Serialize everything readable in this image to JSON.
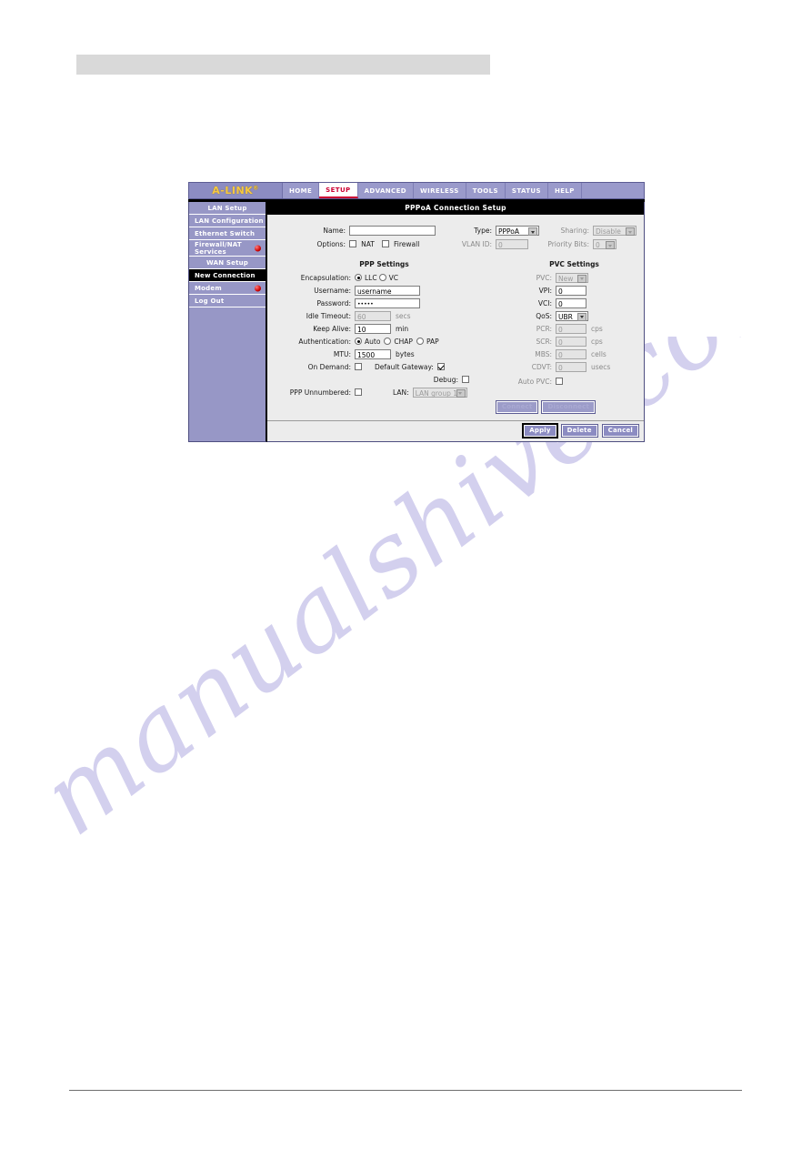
{
  "brand": {
    "name": "A-LINK",
    "trademark": "®"
  },
  "nav": {
    "tabs": [
      {
        "label": "HOME",
        "active": false
      },
      {
        "label": "SETUP",
        "active": true
      },
      {
        "label": "ADVANCED",
        "active": false
      },
      {
        "label": "WIRELESS",
        "active": false
      },
      {
        "label": "TOOLS",
        "active": false
      },
      {
        "label": "STATUS",
        "active": false
      },
      {
        "label": "HELP",
        "active": false
      }
    ]
  },
  "sidebar": {
    "items": [
      {
        "label": "LAN Setup",
        "type": "header",
        "dot": false,
        "selected": false
      },
      {
        "label": "LAN Configuration",
        "type": "item",
        "dot": false,
        "selected": false
      },
      {
        "label": "Ethernet Switch",
        "type": "item",
        "dot": false,
        "selected": false
      },
      {
        "label": "Firewall/NAT Services",
        "type": "item-two-line",
        "dot": true,
        "selected": false
      },
      {
        "label": "WAN Setup",
        "type": "header",
        "dot": false,
        "selected": false
      },
      {
        "label": "New Connection",
        "type": "item",
        "dot": false,
        "selected": true
      },
      {
        "label": "Modem",
        "type": "item",
        "dot": true,
        "selected": false
      },
      {
        "label": "Log Out",
        "type": "item",
        "dot": false,
        "selected": false
      }
    ]
  },
  "page": {
    "title": "PPPoA Connection Setup"
  },
  "top": {
    "name_label": "Name:",
    "name_value": "",
    "options_label": "Options:",
    "nat_label": "NAT",
    "nat_checked": false,
    "firewall_label": "Firewall",
    "firewall_checked": false,
    "type_label": "Type:",
    "type_value": "PPPoA",
    "vlan_label": "VLAN ID:",
    "vlan_value": "0",
    "sharing_label": "Sharing:",
    "sharing_value": "Disable",
    "priority_label": "Priority Bits:",
    "priority_value": "0"
  },
  "ppp": {
    "heading": "PPP Settings",
    "encapsulation_label": "Encapsulation:",
    "enc_llc_label": "LLC",
    "enc_llc_checked": true,
    "enc_vc_label": "VC",
    "enc_vc_checked": false,
    "username_label": "Username:",
    "username_value": "username",
    "password_label": "Password:",
    "password_value": "•••••",
    "idle_label": "Idle Timeout:",
    "idle_value": "60",
    "idle_unit": "secs",
    "keepalive_label": "Keep Alive:",
    "keepalive_value": "10",
    "keepalive_unit": "min",
    "auth_label": "Authentication:",
    "auth_auto_label": "Auto",
    "auth_auto_checked": true,
    "auth_chap_label": "CHAP",
    "auth_chap_checked": false,
    "auth_pap_label": "PAP",
    "auth_pap_checked": false,
    "mtu_label": "MTU:",
    "mtu_value": "1500",
    "mtu_unit": "bytes",
    "ondemand_label": "On Demand:",
    "ondemand_checked": false,
    "gateway_label": "Default Gateway:",
    "gateway_checked": true,
    "debug_label": "Debug:",
    "debug_checked": false,
    "unnumbered_label": "PPP Unnumbered:",
    "unnumbered_checked": false,
    "lan_label": "LAN:",
    "lan_value": "LAN group 1",
    "connect_label": "Connect",
    "disconnect_label": "Disconnect"
  },
  "pvc": {
    "heading": "PVC Settings",
    "pvc_label": "PVC:",
    "pvc_value": "New",
    "vpi_label": "VPI:",
    "vpi_value": "0",
    "vci_label": "VCI:",
    "vci_value": "0",
    "qos_label": "QoS:",
    "qos_value": "UBR",
    "pcr_label": "PCR:",
    "pcr_value": "0",
    "pcr_unit": "cps",
    "scr_label": "SCR:",
    "scr_value": "0",
    "scr_unit": "cps",
    "mbs_label": "MBS:",
    "mbs_value": "0",
    "mbs_unit": "cells",
    "cdvt_label": "CDVT:",
    "cdvt_value": "0",
    "cdvt_unit": "usecs",
    "autopvc_label": "Auto PVC:",
    "autopvc_checked": false
  },
  "footer": {
    "apply_label": "Apply",
    "delete_label": "Delete",
    "cancel_label": "Cancel"
  },
  "watermark": {
    "text": "manualshive.com"
  },
  "colors": {
    "brand_purple": "#8c8cc2",
    "sidebar_purple": "#9797c6",
    "logo_gold": "#f5c842",
    "active_tab_red": "#cc0033",
    "content_gray": "#ececec",
    "watermark_purple": "#b9b4e4"
  }
}
